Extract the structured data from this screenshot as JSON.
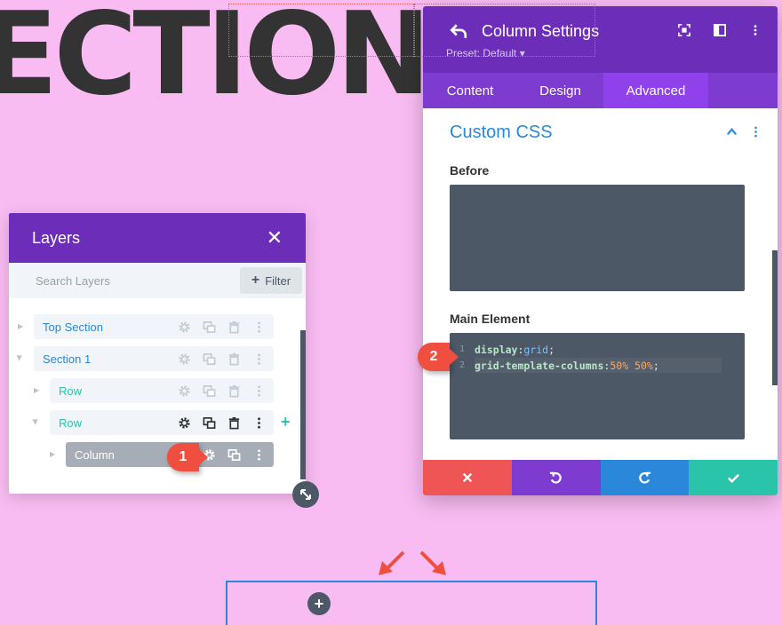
{
  "background": {
    "headline": "ECTION",
    "color": "#f9bcf2"
  },
  "layers_panel": {
    "title": "Layers",
    "search_placeholder": "Search Layers",
    "filter_label": "Filter",
    "items": [
      {
        "label": "Top Section",
        "color": "#2b87da"
      },
      {
        "label": "Section 1",
        "color": "#2b87da"
      },
      {
        "label": "Row",
        "color": "#29c4a9"
      },
      {
        "label": "Row",
        "color": "#29c4a9"
      },
      {
        "label": "Column",
        "color": "#ffffff"
      }
    ]
  },
  "callouts": {
    "one": "1",
    "two": "2"
  },
  "settings_panel": {
    "title": "Column Settings",
    "preset": "Preset: Default ▾",
    "tabs": [
      "Content",
      "Design",
      "Advanced"
    ],
    "active_tab": "Advanced",
    "section_title": "Custom CSS",
    "before_label": "Before",
    "main_label": "Main Element",
    "code": {
      "line_numbers": [
        "1",
        "2"
      ],
      "line1_prop": "display",
      "line1_sep": ":",
      "line1_val": "grid",
      "line1_end": ";",
      "line2_prop": "grid-template-columns",
      "line2_sep": ":",
      "line2_val": "50% 50%",
      "line2_end": ";"
    },
    "actions": [
      {
        "name": "discard",
        "color": "#ef5555"
      },
      {
        "name": "undo",
        "color": "#7e3bd0"
      },
      {
        "name": "redo",
        "color": "#2b87da"
      },
      {
        "name": "save",
        "color": "#29c4a9"
      }
    ]
  }
}
